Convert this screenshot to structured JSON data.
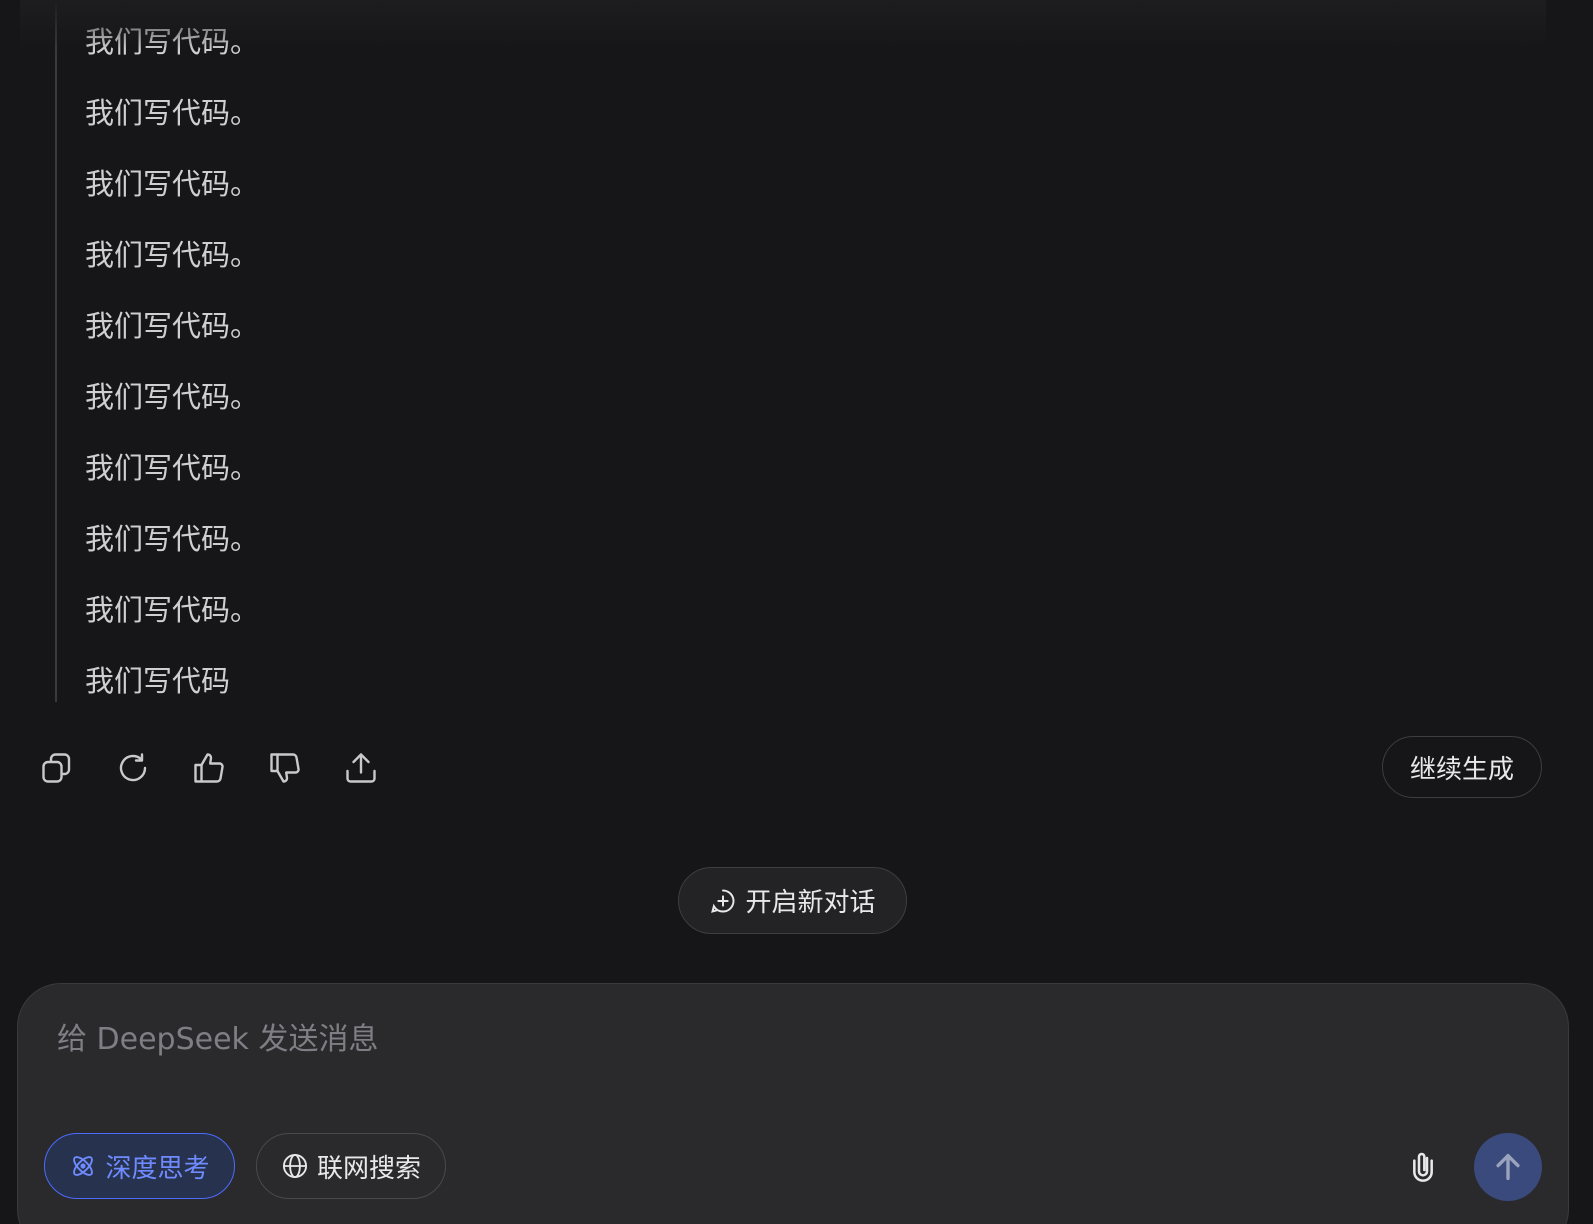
{
  "thinking": {
    "lines": [
      "我们写代码。",
      "我们写代码。",
      "我们写代码。",
      "我们写代码。",
      "我们写代码。",
      "我们写代码。",
      "我们写代码。",
      "我们写代码。",
      "我们写代码。",
      "我们写代码"
    ]
  },
  "actions": {
    "icons": [
      "copy-icon",
      "regenerate-icon",
      "thumbs-up-icon",
      "thumbs-down-icon",
      "share-icon"
    ],
    "continue_label": "继续生成"
  },
  "new_chat": {
    "label": "开启新对话"
  },
  "composer": {
    "placeholder": "给 DeepSeek 发送消息",
    "value": "",
    "deep_think_label": "深度思考",
    "web_search_label": "联网搜索",
    "accent_color": "#4d6bfe"
  }
}
